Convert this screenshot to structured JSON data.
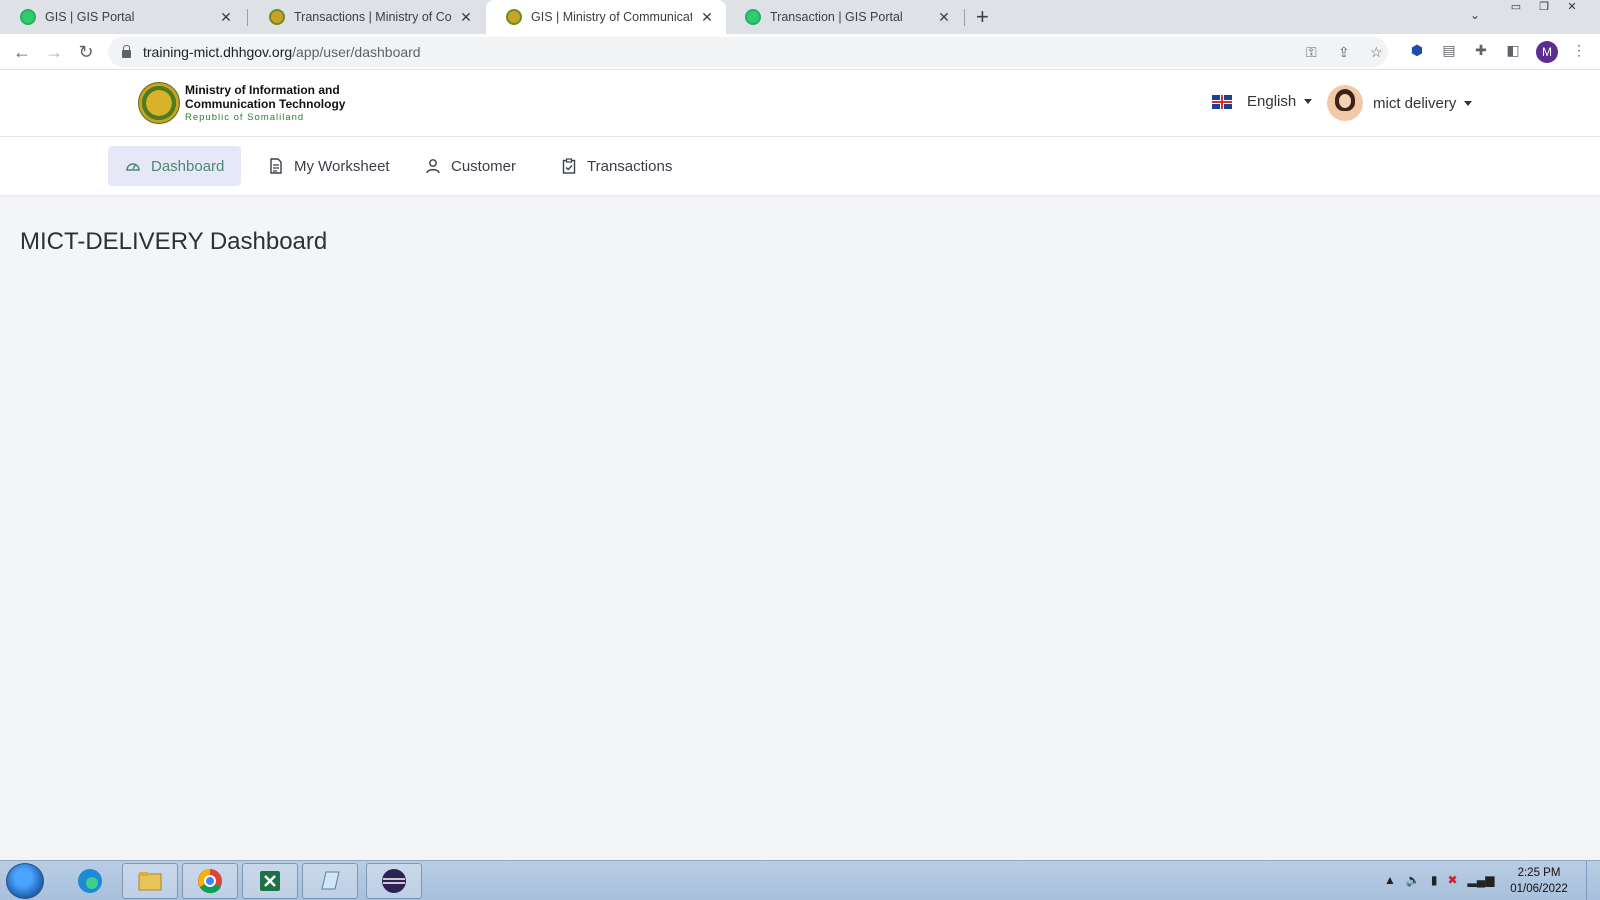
{
  "browser": {
    "tabs": [
      {
        "title": "GIS | GIS Portal",
        "favicon": "gis-favicon",
        "active": false
      },
      {
        "title": "Transactions | Ministry of Comm",
        "favicon": "ministry-seal-favicon",
        "active": false
      },
      {
        "title": "GIS | Ministry of Communication",
        "favicon": "ministry-seal-favicon",
        "active": true
      },
      {
        "title": "Transaction | GIS Portal",
        "favicon": "gis-favicon",
        "active": false
      }
    ],
    "url_host": "training-mict.dhhgov.org",
    "url_path": "/app/user/dashboard",
    "profile_initial": "M"
  },
  "header": {
    "logo_line1": "Ministry of Information  and",
    "logo_line2": "Communication Technology",
    "logo_line3": "Republic of Somaliland",
    "language": "English",
    "user_name": "mict delivery"
  },
  "nav": {
    "items": [
      {
        "label": "Dashboard",
        "icon": "gauge-icon",
        "active": true
      },
      {
        "label": "My Worksheet",
        "icon": "document-icon",
        "active": false
      },
      {
        "label": "Customer",
        "icon": "user-icon",
        "active": false
      },
      {
        "label": "Transactions",
        "icon": "clipboard-check-icon",
        "active": false
      }
    ]
  },
  "main": {
    "title": "MICT-DELIVERY Dashboard"
  },
  "taskbar": {
    "apps": [
      "edge-icon",
      "file-explorer-icon",
      "chrome-icon",
      "excel-icon",
      "notepad-icon",
      "eclipse-icon"
    ],
    "time": "2:25 PM",
    "date": "01/06/2022"
  },
  "colors": {
    "accent": "#4a8a73",
    "active_nav_bg": "#e6e8f8",
    "page_bg": "#f3f5f9"
  }
}
